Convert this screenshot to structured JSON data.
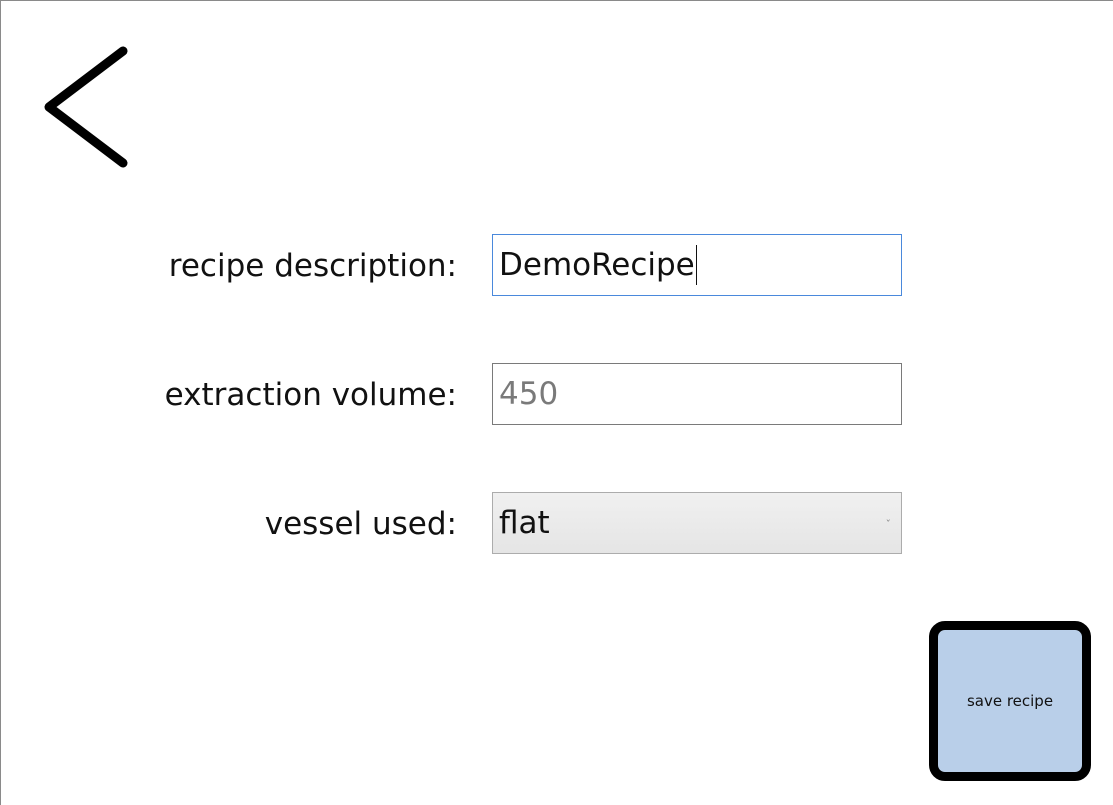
{
  "nav": {
    "back_icon": "chevron-left-icon"
  },
  "form": {
    "description": {
      "label": "recipe description:",
      "value": "DemoRecipe"
    },
    "volume": {
      "label": "extraction volume:",
      "placeholder": "450"
    },
    "vessel": {
      "label": "vessel used:",
      "selected": "flat",
      "chevron_icon": "chevron-down-icon"
    }
  },
  "actions": {
    "save_label": "save recipe"
  },
  "colors": {
    "focus_border": "#4a89dc",
    "save_button_fill": "#b9cfe9",
    "save_button_border": "#000000"
  }
}
